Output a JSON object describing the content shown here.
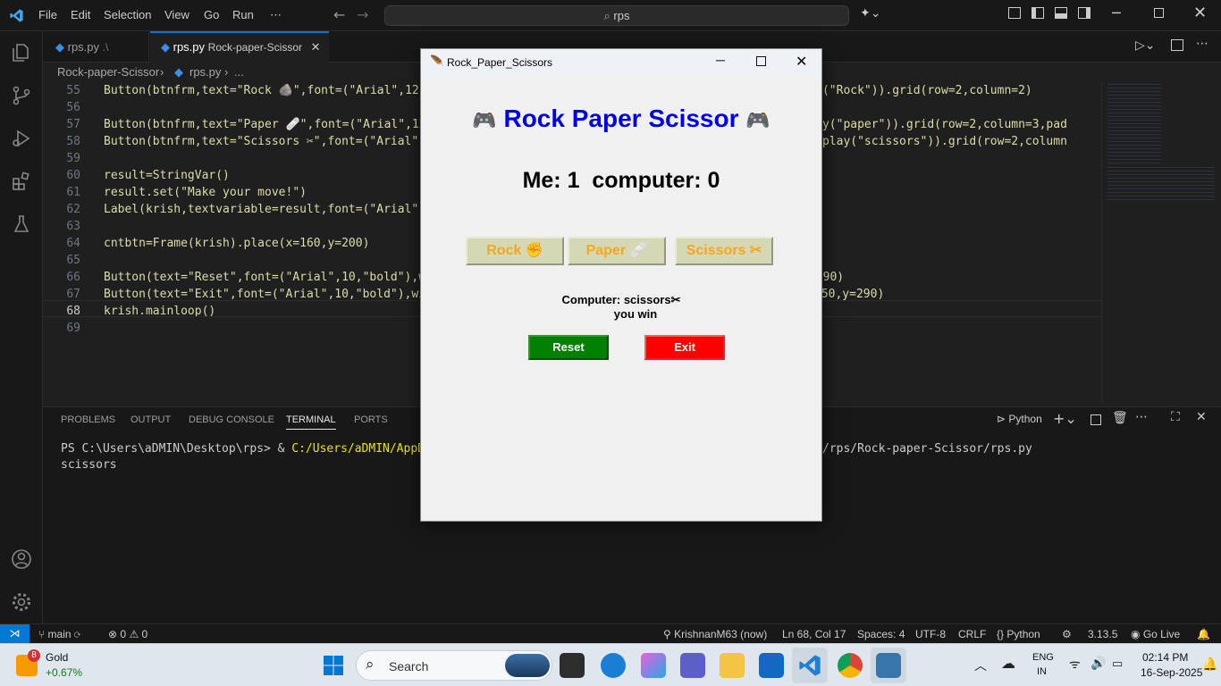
{
  "menu": [
    "File",
    "Edit",
    "Selection",
    "View",
    "Go",
    "Run",
    "⋯"
  ],
  "search_text": "rps",
  "tabs": [
    {
      "label": "rps.py",
      "hint": ".\\",
      "active": false
    },
    {
      "label": "rps.py",
      "hint": "Rock-paper-Scissor",
      "active": true
    }
  ],
  "breadcrumb": {
    "folder": "Rock-paper-Scissor",
    "file": "rps.py",
    "more": "..."
  },
  "code_lines": [
    {
      "n": "55",
      "t": "Button(btnfrm,text=\"Rock 🪨\",font=(\"Arial\",12,"
    },
    {
      "n": "56",
      "t": ""
    },
    {
      "n": "57",
      "t": "Button(btnfrm,text=\"Paper 🩹\",font=(\"Arial\",12,"
    },
    {
      "n": "58",
      "t": "Button(btnfrm,text=\"Scissors ✂\",font=(\"Arial\""
    },
    {
      "n": "59",
      "t": ""
    },
    {
      "n": "60",
      "t": "result=StringVar()"
    },
    {
      "n": "61",
      "t": "result.set(\"Make your move!\")"
    },
    {
      "n": "62",
      "t": "Label(krish,textvariable=result,font=(\"Arial\","
    },
    {
      "n": "63",
      "t": ""
    },
    {
      "n": "64",
      "t": "cntbtn=Frame(krish).place(x=160,y=200)"
    },
    {
      "n": "65",
      "t": ""
    },
    {
      "n": "66",
      "t": "Button(text=\"Reset\",font=(\"Arial\",10,\"bold\"),wi"
    },
    {
      "n": "67",
      "t": "Button(text=\"Exit\",font=(\"Arial\",10,\"bold\"),wi"
    },
    {
      "n": "68",
      "t": "krish.mainloop()"
    },
    {
      "n": "69",
      "t": ""
    }
  ],
  "code_right": [
    {
      "n": "55",
      "t": "a:play(\"Rock\")).grid(row=2,column=2)"
    },
    {
      "n": "57",
      "t": "da:play(\"paper\")).grid(row=2,column=3,pad"
    },
    {
      "n": "58",
      "t": "ambda:play(\"scissors\")).grid(row=2,column"
    },
    {
      "n": "66",
      "t": "=290)"
    },
    {
      "n": "67",
      "t": "250,y=290)"
    }
  ],
  "panel_tabs": [
    "PROBLEMS",
    "OUTPUT",
    "DEBUG CONSOLE",
    "TERMINAL",
    "PORTS"
  ],
  "panel_shell": "Python",
  "terminal": {
    "line1_left": "PS C:\\Users\\aDMIN\\Desktop\\rps> & ",
    "line1_path": "C:/Users/aDMIN/AppData/Lo",
    "line1_right": "/rps/Rock-paper-Scissor/rps.py",
    "line2": "scissors"
  },
  "status": {
    "branch": "main",
    "errors": "0",
    "warnings": "0",
    "user": "KrishnanM63 (now)",
    "position": "Ln 68, Col 17",
    "spaces": "Spaces: 4",
    "encoding": "UTF-8",
    "eol": "CRLF",
    "language": "Python",
    "py_version": "3.13.5",
    "golive": "Go Live"
  },
  "tk": {
    "title": "Rock_Paper_Scissors",
    "heading": "Rock Paper Scissor",
    "score": "Me: 1  computer: 0",
    "buttons": [
      "Rock ✊",
      "Paper 🩹",
      "Scissors ✂"
    ],
    "computer_choice": "Computer: scissors✂",
    "result": "you win",
    "reset": "Reset",
    "exit": "Exit"
  },
  "taskbar": {
    "stock_name": "Gold",
    "stock_change": "+0.67%",
    "badge": "8",
    "search": "Search",
    "lang1": "ENG",
    "lang2": "IN",
    "time": "02:14 PM",
    "date": "16-Sep-2025"
  },
  "colors": {
    "accent_blue": "#0078d4",
    "reset_green": "#008000",
    "exit_red": "#ff0000",
    "heading_blue": "#0000e6",
    "button_text": "#f5a623"
  }
}
